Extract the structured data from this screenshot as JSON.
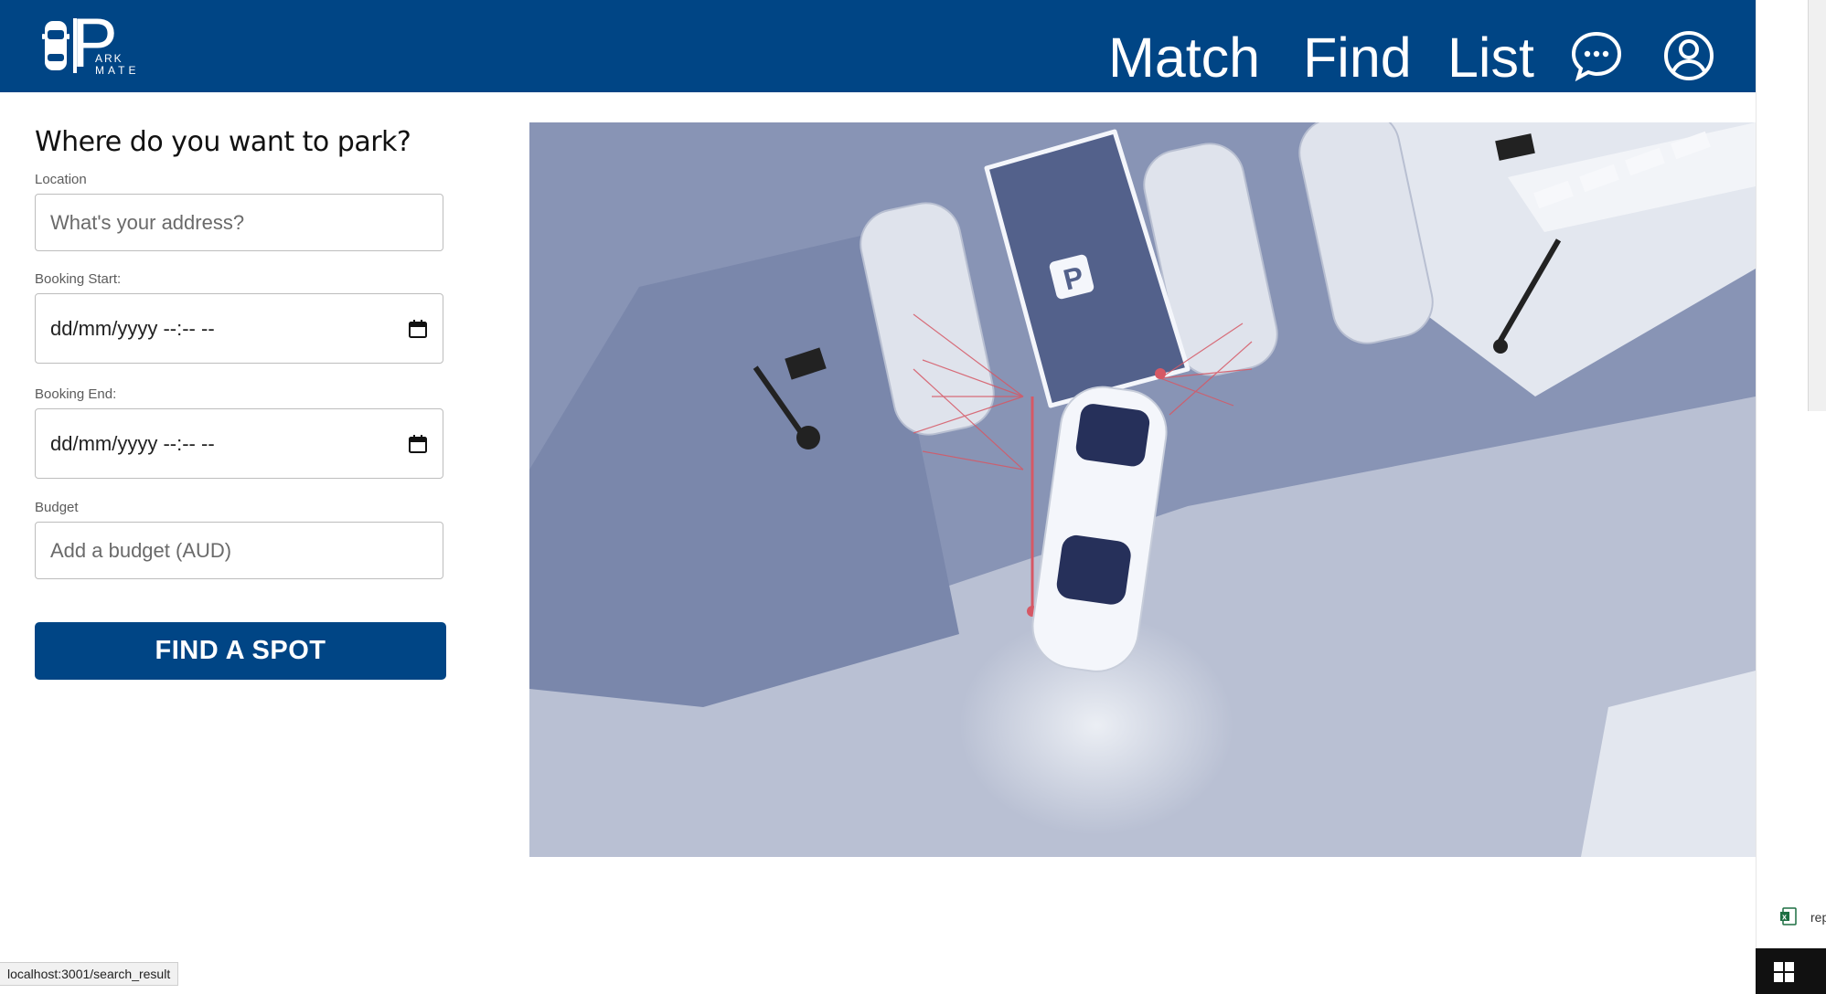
{
  "nav": {
    "logo_letter": "P",
    "logo_line1": "ARK",
    "logo_line2": "MATE",
    "links": [
      "Match",
      "Find",
      "List"
    ],
    "icons": [
      "chat-bubble-icon",
      "user-account-icon"
    ],
    "background": "#004585"
  },
  "search": {
    "title": "Where do you want to park?",
    "location_label": "Location",
    "location_placeholder": "What's your address?",
    "start_label": "Booking Start:",
    "start_value": "dd/mm/yyyy --:-- --",
    "end_label": "Booking End:",
    "end_value": "dd/mm/yyyy --:-- --",
    "budget_label": "Budget",
    "budget_placeholder": "Add a budget (AUD)",
    "button_label": "FIND A SPOT"
  },
  "hero": {
    "parking_sign": "P"
  },
  "taskbar": {
    "download_text": "rep",
    "icons": [
      "excel-file-icon",
      "windows-start-icon"
    ]
  },
  "status_bar": {
    "url": "localhost:3001/search_result"
  }
}
